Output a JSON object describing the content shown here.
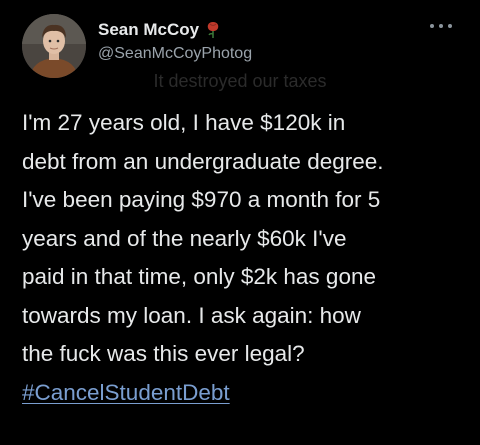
{
  "tweet": {
    "author": {
      "display_name": "Sean McCoy",
      "handle": "@SeanMcCoyPhotog",
      "badge_icon": "rose-icon",
      "avatar_icon": "avatar"
    },
    "more_icon": "more-icon",
    "watermark_text": "It destroyed our taxes",
    "body_lines": [
      "I'm 27 years old, I have $120k in",
      "debt from an undergraduate degree.",
      "I've been paying $970 a month for 5",
      "years and of the nearly $60k I've",
      "paid in that time, only $2k has gone",
      "towards my loan. I ask again: how",
      "the fuck was this ever legal?"
    ],
    "hashtag": "#CancelStudentDebt"
  },
  "colors": {
    "background": "#000000",
    "text": "#e7e9ea",
    "secondary_text": "#9aa3ab",
    "hashtag": "#7a9ed0",
    "badge": "#c0392b"
  }
}
